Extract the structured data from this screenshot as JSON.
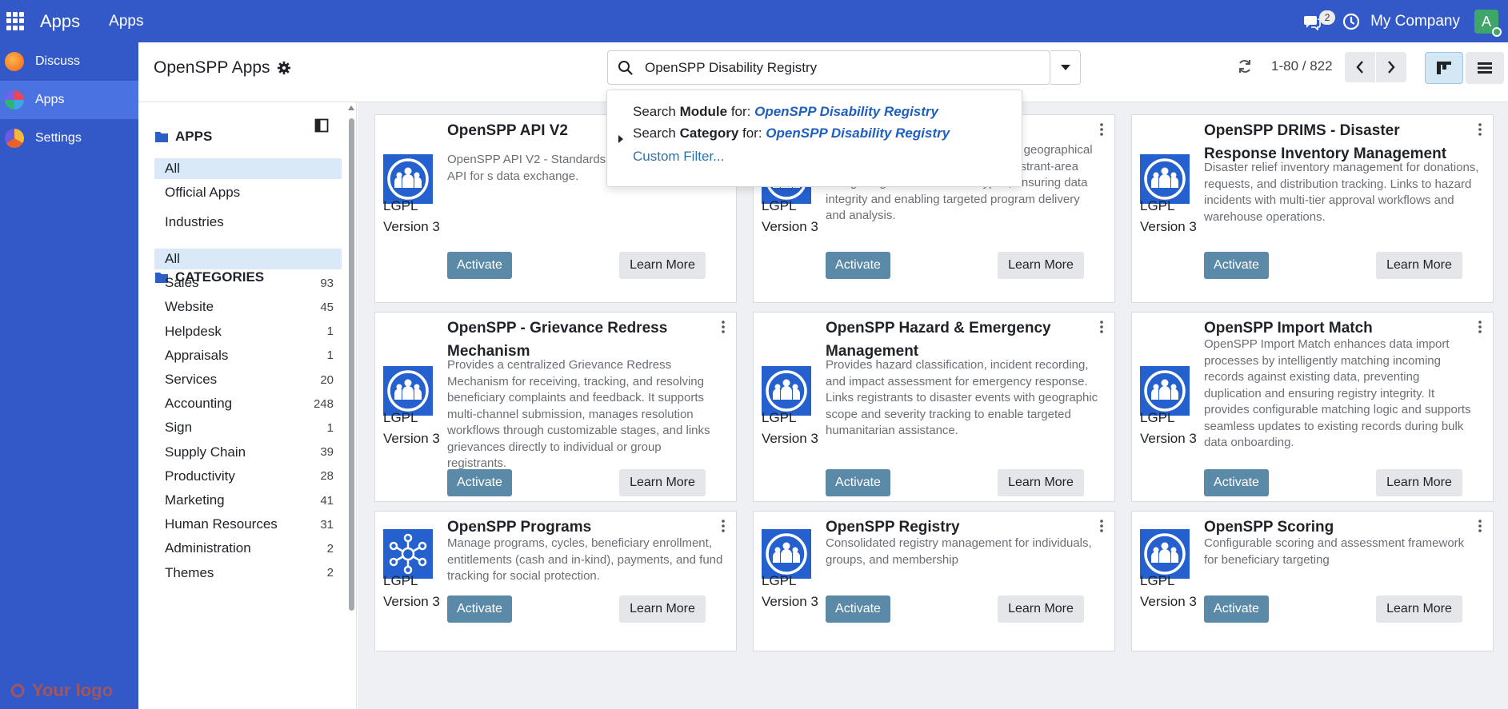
{
  "topbar": {
    "app_name": "Apps",
    "menu_apps": "Apps",
    "message_count": "2",
    "company": "My Company",
    "avatar_letter": "A"
  },
  "rail": {
    "items": [
      {
        "label": "Discuss",
        "icon": "discuss-icon",
        "color": "#f27a2a"
      },
      {
        "label": "Apps",
        "icon": "apps-icon",
        "color": "#3ea6e8"
      },
      {
        "label": "Settings",
        "icon": "settings-icon",
        "color": "#e8622e"
      }
    ],
    "logo_text": "Your logo"
  },
  "control_panel": {
    "title": "OpenSPP Apps",
    "search_value": "OpenSPP Disability Registry",
    "pager_text": "1-80 / 822"
  },
  "search_dropdown": {
    "module_prefix": "Search ",
    "module_field": "Module",
    "module_suffix": " for: ",
    "module_query": "OpenSPP Disability Registry",
    "category_prefix": "Search ",
    "category_field": "Category",
    "category_suffix": " for: ",
    "category_query": "OpenSPP Disability Registry",
    "custom_filter": "Custom Filter..."
  },
  "search_panel": {
    "apps_header": "APPS",
    "apps_items": [
      {
        "label": "All"
      },
      {
        "label": "Official Apps"
      },
      {
        "label": "Industries"
      }
    ],
    "categories_header": "CATEGORIES",
    "categories": [
      {
        "label": "All",
        "count": ""
      },
      {
        "label": "Sales",
        "count": "93"
      },
      {
        "label": "Website",
        "count": "45"
      },
      {
        "label": "Helpdesk",
        "count": "1"
      },
      {
        "label": "Appraisals",
        "count": "1"
      },
      {
        "label": "Services",
        "count": "20"
      },
      {
        "label": "Accounting",
        "count": "248"
      },
      {
        "label": "Sign",
        "count": "1"
      },
      {
        "label": "Supply Chain",
        "count": "39"
      },
      {
        "label": "Productivity",
        "count": "28"
      },
      {
        "label": "Marketing",
        "count": "41"
      },
      {
        "label": "Human Resources",
        "count": "31"
      },
      {
        "label": "Administration",
        "count": "2"
      },
      {
        "label": "Themes",
        "count": "2"
      }
    ]
  },
  "cards": [
    {
      "title": "OpenSPP API V2",
      "desc": "OpenSPP API V2 - Standards consent-respecting API for s data exchange.",
      "license": "LGPL",
      "version": "Version 3",
      "activate": "Activate",
      "learn_more": "Learn More"
    },
    {
      "title": "",
      "desc": "ween roups, and their corresponding geographical administrative areas. It validates registrant-area linkages against official area types, ensuring data integrity and enabling targeted program delivery and analysis.",
      "license": "LGPL",
      "version": "Version 3",
      "activate": "Activate",
      "learn_more": "Learn More"
    },
    {
      "title": "OpenSPP DRIMS - Disaster Response Inventory Management",
      "desc": "Disaster relief inventory management for donations, requests, and distribution tracking. Links to hazard incidents with multi-tier approval workflows and warehouse operations.",
      "license": "LGPL",
      "version": "Version 3",
      "activate": "Activate",
      "learn_more": "Learn More"
    },
    {
      "title": "OpenSPP - Grievance Redress Mechanism",
      "desc": "Provides a centralized Grievance Redress Mechanism for receiving, tracking, and resolving beneficiary complaints and feedback. It supports multi-channel submission, manages resolution workflows through customizable stages, and links grievances directly to individual or group registrants.",
      "license": "LGPL",
      "version": "Version 3",
      "activate": "Activate",
      "learn_more": "Learn More"
    },
    {
      "title": "OpenSPP Hazard & Emergency Management",
      "desc": "Provides hazard classification, incident recording, and impact assessment for emergency response. Links registrants to disaster events with geographic scope and severity tracking to enable targeted humanitarian assistance.",
      "license": "LGPL",
      "version": "Version 3",
      "activate": "Activate",
      "learn_more": "Learn More"
    },
    {
      "title": "OpenSPP Import Match",
      "desc": "OpenSPP Import Match enhances data import processes by intelligently matching incoming records against existing data, preventing duplication and ensuring registry integrity. It provides configurable matching logic and supports seamless updates to existing records during bulk data onboarding.",
      "license": "LGPL",
      "version": "Version 3",
      "activate": "Activate",
      "learn_more": "Learn More"
    },
    {
      "title": "OpenSPP Programs",
      "desc": "Manage programs, cycles, beneficiary enrollment, entitlements (cash and in-kind), payments, and fund tracking for social protection.",
      "license": "LGPL",
      "version": "Version 3",
      "activate": "Activate",
      "learn_more": "Learn More"
    },
    {
      "title": "OpenSPP Registry",
      "desc": "Consolidated registry management for individuals, groups, and membership",
      "license": "LGPL",
      "version": "Version 3",
      "activate": "Activate",
      "learn_more": "Learn More"
    },
    {
      "title": "OpenSPP Scoring",
      "desc": "Configurable scoring and assessment framework for beneficiary targeting",
      "license": "LGPL",
      "version": "Version 3",
      "activate": "Activate",
      "learn_more": "Learn More"
    }
  ]
}
